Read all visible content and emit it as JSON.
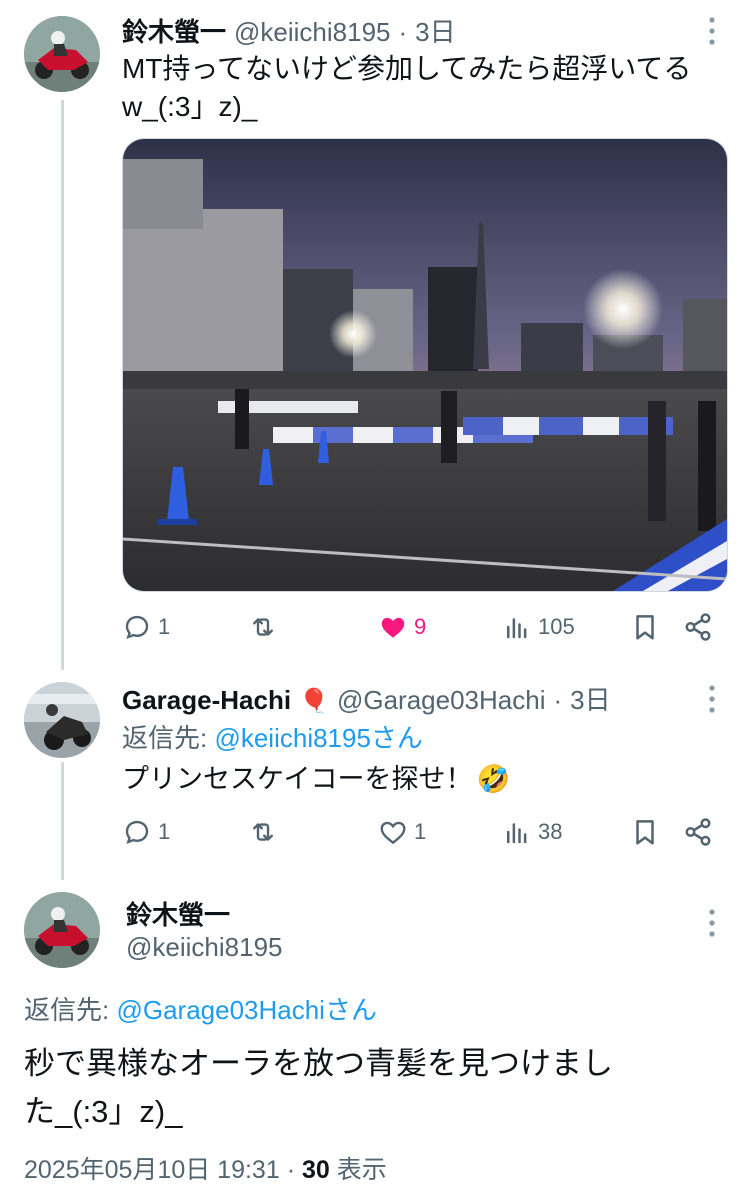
{
  "tweet1": {
    "name": "鈴木螢一",
    "handle": "@keiichi8195",
    "dot": "·",
    "time": "3日",
    "text_line1": "MT持ってないけど参加してみたら超浮いてる",
    "text_line2": "w_(:3」z)_",
    "actions": {
      "replies": "1",
      "retweets": "",
      "likes": "9",
      "views": "105"
    },
    "like_color": "#f91880"
  },
  "tweet2": {
    "name": "Garage-Hachi",
    "name_emoji": "🎈",
    "handle": "@Garage03Hachi",
    "dot": "·",
    "time": "3日",
    "reply_prefix": "返信先: ",
    "reply_to": "@keiichi8195さん",
    "text": "プリンセスケイコーを探せ！",
    "text_emoji": "🤣",
    "actions": {
      "replies": "1",
      "retweets": "",
      "likes": "1",
      "views": "38"
    }
  },
  "tweet3": {
    "name": "鈴木螢一",
    "handle": "@keiichi8195",
    "reply_prefix": "返信先: ",
    "reply_to": "@Garage03Hachiさん",
    "text_line1": "秒で異様なオーラを放つ青髪を見つけまし",
    "text_line2": "た_(:3」z)_",
    "date": "2025年05月10日 19:31",
    "dot": "·",
    "view_count": "30",
    "view_label": "表示"
  },
  "colors": {
    "accent": "#1d9bf0",
    "muted": "#536471",
    "like": "#f91880"
  }
}
